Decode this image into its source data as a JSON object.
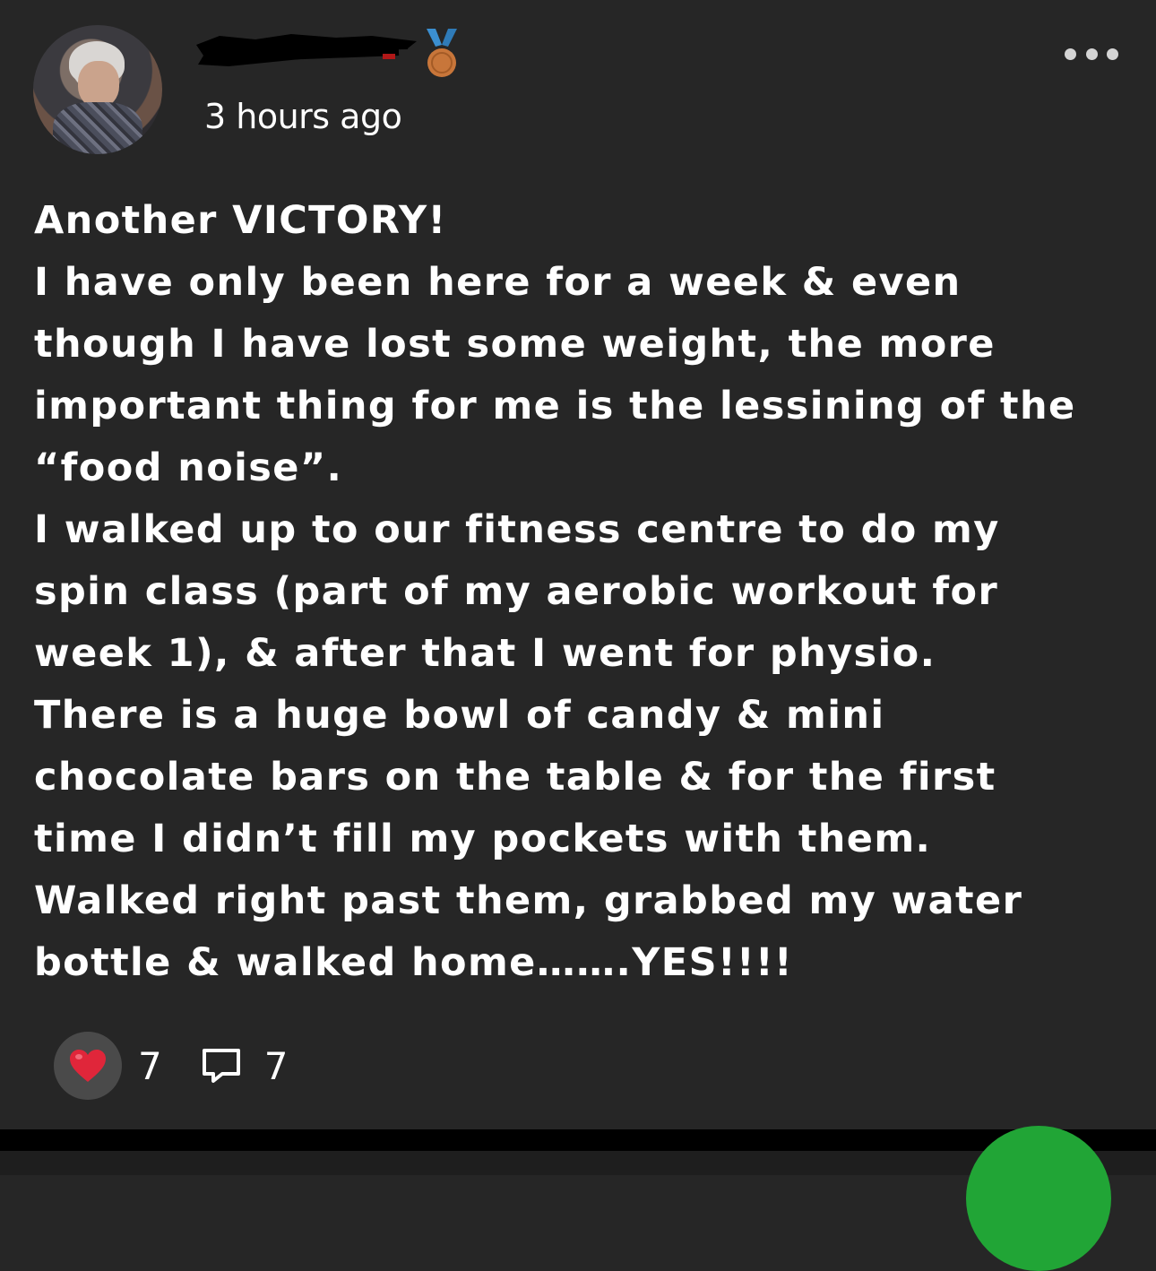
{
  "post": {
    "timestamp": "3 hours ago",
    "body_lines": [
      "Another VICTORY!",
      "I have only been here for a week & even",
      "though I have lost some weight, the more",
      "important thing for me is the lessining of the",
      "“food noise”.",
      "I walked up to our fitness centre to do my",
      "spin class (part of my aerobic workout for",
      "week 1), & after that I went for physio.",
      "There is a huge bowl of candy & mini",
      "chocolate bars on the table & for the first",
      "time I didn’t fill my pockets with them.",
      "Walked right past them, grabbed my water",
      "bottle & walked home…….YES!!!!"
    ],
    "like_count": "7",
    "comment_count": "7"
  },
  "icons": {
    "more": "more-horizontal-icon",
    "like": "heart-icon",
    "comment": "comment-icon",
    "badge": "bronze-medal-icon"
  },
  "colors": {
    "background": "#262626",
    "text": "#ffffff",
    "heart": "#e0263a",
    "medal": "#c8763a",
    "ribbon": "#3b8fd0",
    "fab": "#21a536"
  }
}
